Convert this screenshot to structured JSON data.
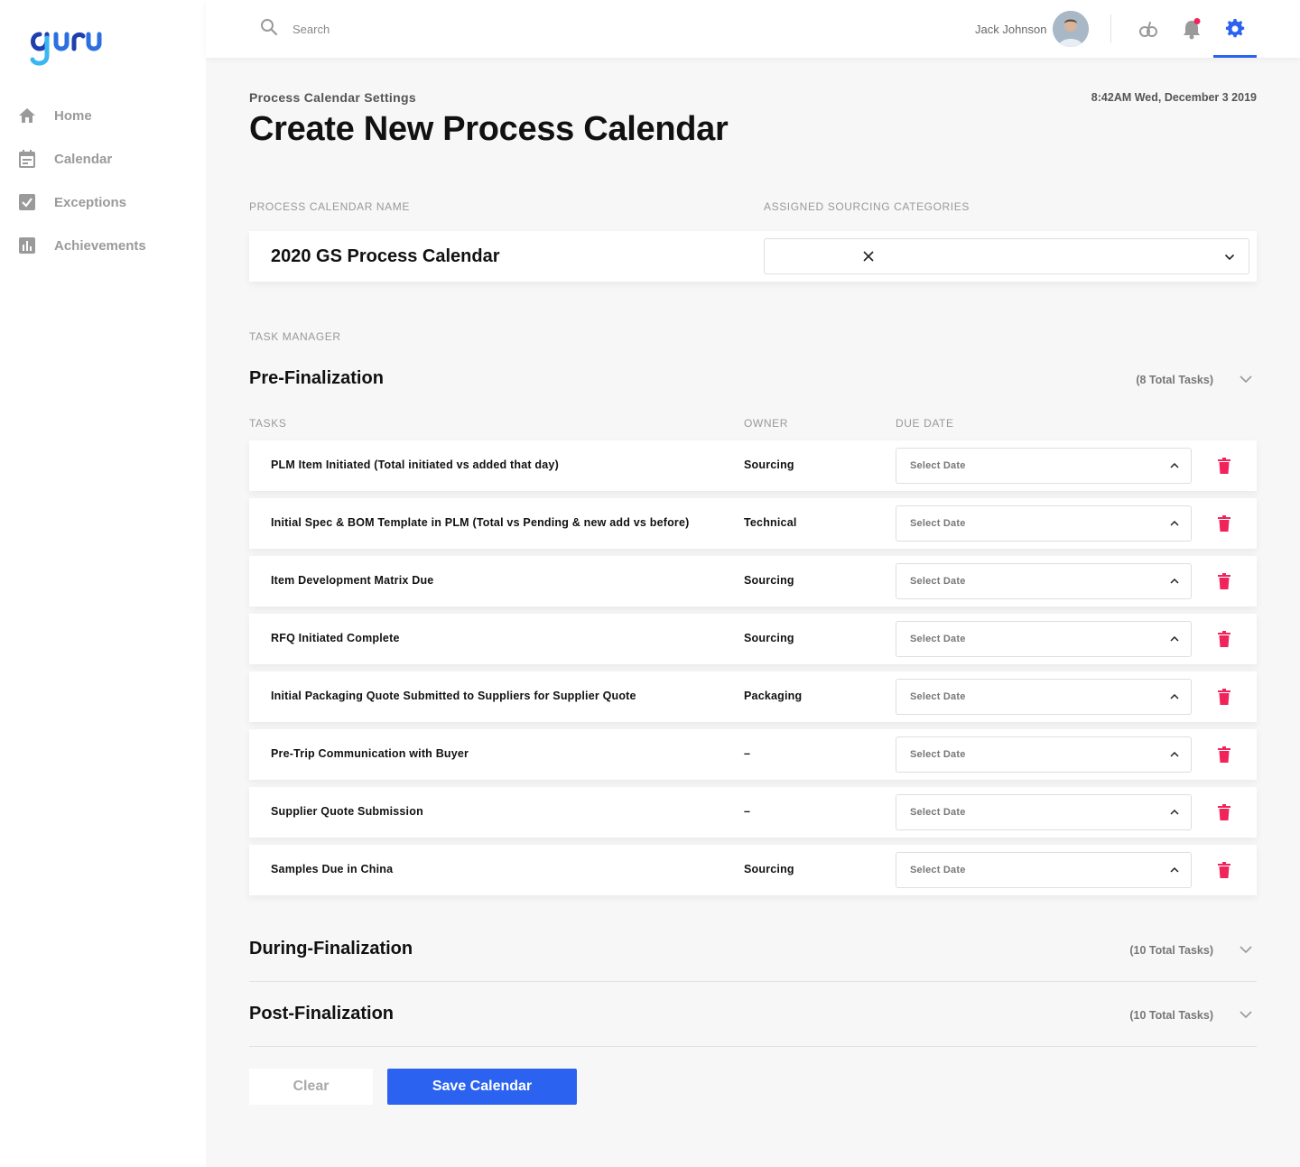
{
  "app": {
    "logo_text": "guru"
  },
  "sidebar": {
    "items": [
      {
        "label": "Home",
        "icon": "home-icon"
      },
      {
        "label": "Calendar",
        "icon": "calendar-icon"
      },
      {
        "label": "Exceptions",
        "icon": "checkbox-icon"
      },
      {
        "label": "Achievements",
        "icon": "bar-chart-icon"
      }
    ]
  },
  "topbar": {
    "search_placeholder": "Search",
    "user_name": "Jack Johnson",
    "icons": [
      "link-icon",
      "bell-icon",
      "gear-icon"
    ],
    "notification_dot_color": "#f0245a",
    "active_color": "#2b63f0"
  },
  "page": {
    "breadcrumb": "Process Calendar Settings",
    "datetime": "8:42AM Wed, December 3 2019",
    "title": "Create New Process Calendar"
  },
  "form": {
    "name_label": "PROCESS CALENDAR NAME",
    "name_value": "2020 GS Process Calendar",
    "categories_label": "ASSIGNED SOURCING CATEGORIES",
    "categories_value": ""
  },
  "task_manager": {
    "label": "TASK MANAGER",
    "columns": {
      "tasks": "TASKS",
      "owner": "OWNER",
      "due_date": "DUE DATE"
    },
    "groups": [
      {
        "title": "Pre-Finalization",
        "count": "(8 Total Tasks)",
        "expanded": true,
        "tasks": [
          {
            "name": "PLM Item Initiated (Total initiated vs added that day)",
            "owner": "Sourcing",
            "due": "Select Date"
          },
          {
            "name": "Initial Spec & BOM Template in PLM (Total vs Pending & new add vs before)",
            "owner": "Technical",
            "due": "Select Date"
          },
          {
            "name": "Item Development Matrix Due",
            "owner": "Sourcing",
            "due": "Select Date"
          },
          {
            "name": "RFQ Initiated Complete",
            "owner": "Sourcing",
            "due": "Select Date"
          },
          {
            "name": "Initial Packaging Quote Submitted to Suppliers for Supplier Quote",
            "owner": "Packaging",
            "due": "Select Date"
          },
          {
            "name": "Pre-Trip Communication with Buyer",
            "owner": "–",
            "due": "Select Date"
          },
          {
            "name": "Supplier Quote Submission",
            "owner": "–",
            "due": "Select Date"
          },
          {
            "name": "Samples Due in China",
            "owner": "Sourcing",
            "due": "Select Date"
          }
        ]
      },
      {
        "title": "During-Finalization",
        "count": "(10 Total Tasks)",
        "expanded": false
      },
      {
        "title": "Post-Finalization",
        "count": "(10 Total Tasks)",
        "expanded": false
      }
    ]
  },
  "actions": {
    "clear_label": "Clear",
    "save_label": "Save Calendar"
  },
  "colors": {
    "primary": "#2b63f0",
    "delete": "#f0245a",
    "logo_dark": "#1f3fae",
    "logo_light": "#3ab6f2"
  }
}
